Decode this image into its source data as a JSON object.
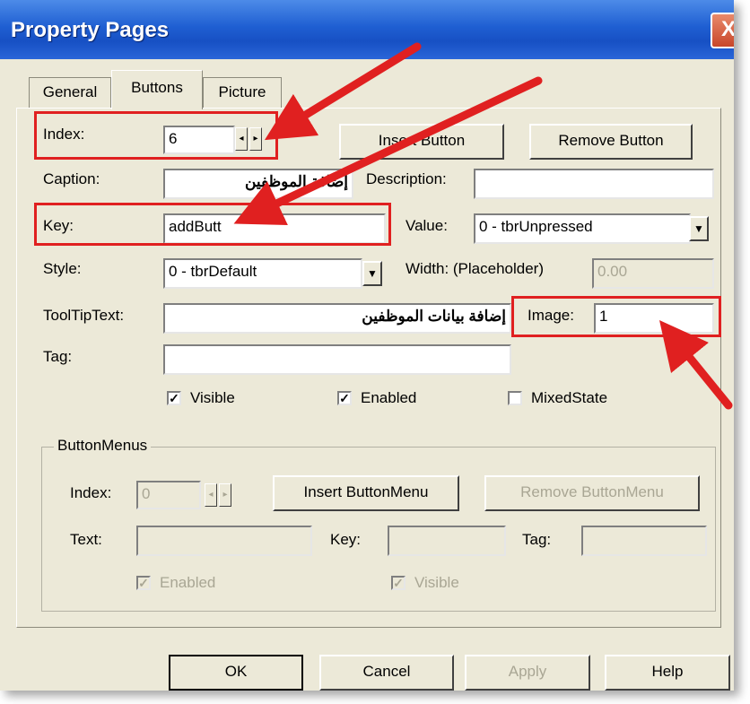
{
  "window": {
    "title": "Property Pages",
    "close_label": "X"
  },
  "tabs": [
    {
      "label": "General"
    },
    {
      "label": "Buttons"
    },
    {
      "label": "Picture"
    }
  ],
  "buttons_page": {
    "index_label": "Index:",
    "index_value": "6",
    "insert_button": "Insert Button",
    "remove_button": "Remove Button",
    "caption_label": "Caption:",
    "caption_value": "إضافة الموظفين",
    "description_label": "Description:",
    "description_value": "",
    "key_label": "Key:",
    "key_value": "addButt",
    "value_label": "Value:",
    "value_value": "0 - tbrUnpressed",
    "style_label": "Style:",
    "style_value": "0 - tbrDefault",
    "width_label": "Width: (Placeholder)",
    "width_value": "0.00",
    "tooltip_label": "ToolTipText:",
    "tooltip_value": "إضافة بيانات الموظفين",
    "image_label": "Image:",
    "image_value": "1",
    "tag_label": "Tag:",
    "tag_value": "",
    "visible_label": "Visible",
    "visible_checked": true,
    "enabled_label": "Enabled",
    "enabled_checked": true,
    "mixedstate_label": "MixedState",
    "mixedstate_checked": false
  },
  "button_menus": {
    "group_title": "ButtonMenus",
    "index_label": "Index:",
    "index_value": "0",
    "insert_label": "Insert ButtonMenu",
    "remove_label": "Remove ButtonMenu",
    "text_label": "Text:",
    "key_label": "Key:",
    "tag_label": "Tag:",
    "enabled_label": "Enabled",
    "visible_label": "Visible"
  },
  "footer": {
    "ok": "OK",
    "cancel": "Cancel",
    "apply": "Apply",
    "help": "Help"
  },
  "annotation_color": "#e02020"
}
